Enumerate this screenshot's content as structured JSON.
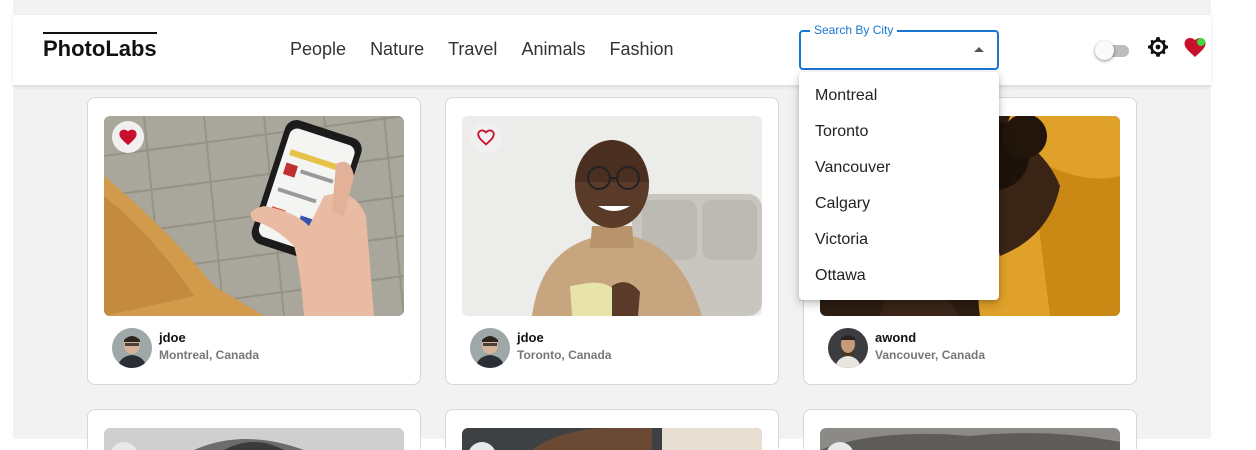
{
  "nav": {
    "logo": "PhotoLabs",
    "topics": [
      "People",
      "Nature",
      "Travel",
      "Animals",
      "Fashion"
    ],
    "city_search": {
      "label": "Search By City",
      "value": ""
    },
    "icons": [
      "toggle-switch",
      "settings-icon",
      "favorite-heart-icon",
      "notification-dot"
    ]
  },
  "dropdown": {
    "options": [
      "Montreal",
      "Toronto",
      "Vancouver",
      "Calgary",
      "Victoria",
      "Ottawa"
    ]
  },
  "photos": [
    {
      "username": "jdoe",
      "location": "Montreal, Canada",
      "liked": true,
      "subject": "hand holding phone"
    },
    {
      "username": "jdoe",
      "location": "Toronto, Canada",
      "liked": false,
      "subject": "smiling man with cup"
    },
    {
      "username": "awond",
      "location": "Vancouver, Canada",
      "liked": false,
      "subject": "woman with curly hair"
    }
  ],
  "colors": {
    "accent": "#1976d2",
    "like": "#c8102e",
    "notification": "#3bdc3b"
  }
}
